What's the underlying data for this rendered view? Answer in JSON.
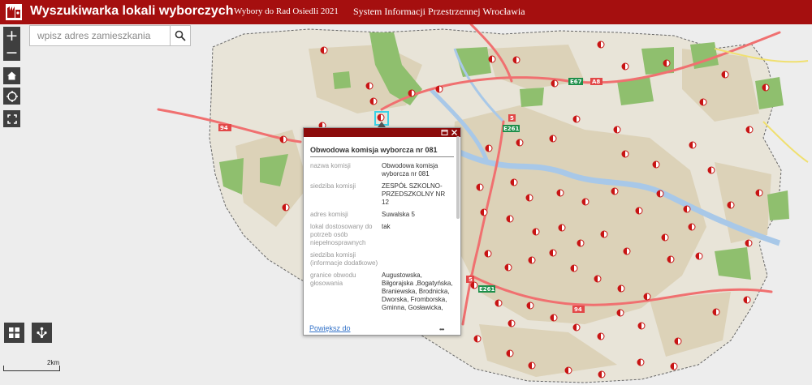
{
  "header": {
    "title": "Wyszukiwarka lokali wyborczych",
    "link_elections": "Wybory do Rad Osiedli 2021",
    "link_sip": "System Informacji Przestrzennej Wrocławia"
  },
  "search": {
    "placeholder": "wpisz adres zamieszkania",
    "value": ""
  },
  "tools": {
    "zoom_in": "+",
    "zoom_out": "−"
  },
  "scale": {
    "label": "2km"
  },
  "map": {
    "road_labels": [
      {
        "name": "94",
        "color": "#e24848"
      },
      {
        "name": "E67",
        "color": "#1e8f4a"
      },
      {
        "name": "A8",
        "color": "#e24848"
      },
      {
        "name": "5",
        "color": "#e24848"
      },
      {
        "name": "E261",
        "color": "#1e8f4a"
      },
      {
        "name": "5",
        "color": "#e24848"
      },
      {
        "name": "E261",
        "color": "#1e8f4a"
      },
      {
        "name": "94",
        "color": "#e24848"
      }
    ]
  },
  "popup": {
    "title": "Obwodowa komisja wyborcza nr 081",
    "fields": [
      {
        "label": "nazwa komisji",
        "value": "Obwodowa komisja wyborcza nr 081"
      },
      {
        "label": "siedziba komisji",
        "value": "ZESPÓŁ SZKOLNO-PRZEDSZKOLNY NR 12"
      },
      {
        "label": "adres komisji",
        "value": "Suwalska 5"
      },
      {
        "label": "lokal dostosowany do potrzeb osób niepełnosprawnych",
        "value": "tak"
      },
      {
        "label": "siedziba komisji (informacje dodatkowe)",
        "value": ""
      },
      {
        "label": "granice obwodu głosowania",
        "value": "Augustowska, Biłgorajska ,Bogatyńska, Braniewska, Brodnicka, Dworska, Fromborska, Gminna, Gosławicka,"
      }
    ],
    "zoom_link": "Powiększ do",
    "more": "•••"
  },
  "colors": {
    "header_bg": "#a50f0f",
    "popup_bar": "#8c0b0b",
    "marker": "#c81414",
    "urban": "#dcd2b8",
    "forest": "#8fbf6e",
    "river": "#a8c8e8"
  }
}
